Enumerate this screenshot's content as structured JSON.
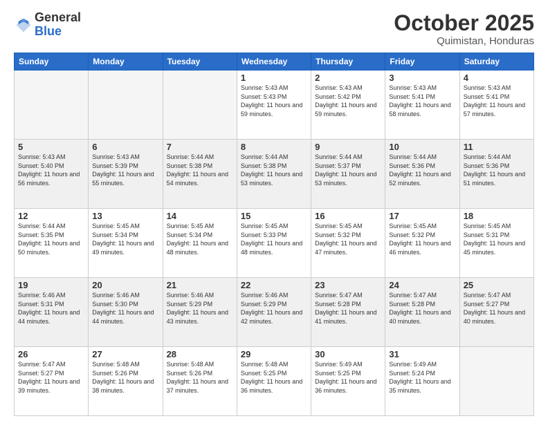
{
  "logo": {
    "general": "General",
    "blue": "Blue"
  },
  "header": {
    "month": "October 2025",
    "location": "Quimistan, Honduras"
  },
  "days_of_week": [
    "Sunday",
    "Monday",
    "Tuesday",
    "Wednesday",
    "Thursday",
    "Friday",
    "Saturday"
  ],
  "weeks": [
    [
      {
        "day": "",
        "empty": true
      },
      {
        "day": "",
        "empty": true
      },
      {
        "day": "",
        "empty": true
      },
      {
        "day": "1",
        "sunrise": "5:43 AM",
        "sunset": "5:43 PM",
        "daylight": "11 hours and 59 minutes."
      },
      {
        "day": "2",
        "sunrise": "5:43 AM",
        "sunset": "5:42 PM",
        "daylight": "11 hours and 59 minutes."
      },
      {
        "day": "3",
        "sunrise": "5:43 AM",
        "sunset": "5:41 PM",
        "daylight": "11 hours and 58 minutes."
      },
      {
        "day": "4",
        "sunrise": "5:43 AM",
        "sunset": "5:41 PM",
        "daylight": "11 hours and 57 minutes."
      }
    ],
    [
      {
        "day": "5",
        "sunrise": "5:43 AM",
        "sunset": "5:40 PM",
        "daylight": "11 hours and 56 minutes."
      },
      {
        "day": "6",
        "sunrise": "5:43 AM",
        "sunset": "5:39 PM",
        "daylight": "11 hours and 55 minutes."
      },
      {
        "day": "7",
        "sunrise": "5:44 AM",
        "sunset": "5:38 PM",
        "daylight": "11 hours and 54 minutes."
      },
      {
        "day": "8",
        "sunrise": "5:44 AM",
        "sunset": "5:38 PM",
        "daylight": "11 hours and 53 minutes."
      },
      {
        "day": "9",
        "sunrise": "5:44 AM",
        "sunset": "5:37 PM",
        "daylight": "11 hours and 53 minutes."
      },
      {
        "day": "10",
        "sunrise": "5:44 AM",
        "sunset": "5:36 PM",
        "daylight": "11 hours and 52 minutes."
      },
      {
        "day": "11",
        "sunrise": "5:44 AM",
        "sunset": "5:36 PM",
        "daylight": "11 hours and 51 minutes."
      }
    ],
    [
      {
        "day": "12",
        "sunrise": "5:44 AM",
        "sunset": "5:35 PM",
        "daylight": "11 hours and 50 minutes."
      },
      {
        "day": "13",
        "sunrise": "5:45 AM",
        "sunset": "5:34 PM",
        "daylight": "11 hours and 49 minutes."
      },
      {
        "day": "14",
        "sunrise": "5:45 AM",
        "sunset": "5:34 PM",
        "daylight": "11 hours and 48 minutes."
      },
      {
        "day": "15",
        "sunrise": "5:45 AM",
        "sunset": "5:33 PM",
        "daylight": "11 hours and 48 minutes."
      },
      {
        "day": "16",
        "sunrise": "5:45 AM",
        "sunset": "5:32 PM",
        "daylight": "11 hours and 47 minutes."
      },
      {
        "day": "17",
        "sunrise": "5:45 AM",
        "sunset": "5:32 PM",
        "daylight": "11 hours and 46 minutes."
      },
      {
        "day": "18",
        "sunrise": "5:45 AM",
        "sunset": "5:31 PM",
        "daylight": "11 hours and 45 minutes."
      }
    ],
    [
      {
        "day": "19",
        "sunrise": "5:46 AM",
        "sunset": "5:31 PM",
        "daylight": "11 hours and 44 minutes."
      },
      {
        "day": "20",
        "sunrise": "5:46 AM",
        "sunset": "5:30 PM",
        "daylight": "11 hours and 44 minutes."
      },
      {
        "day": "21",
        "sunrise": "5:46 AM",
        "sunset": "5:29 PM",
        "daylight": "11 hours and 43 minutes."
      },
      {
        "day": "22",
        "sunrise": "5:46 AM",
        "sunset": "5:29 PM",
        "daylight": "11 hours and 42 minutes."
      },
      {
        "day": "23",
        "sunrise": "5:47 AM",
        "sunset": "5:28 PM",
        "daylight": "11 hours and 41 minutes."
      },
      {
        "day": "24",
        "sunrise": "5:47 AM",
        "sunset": "5:28 PM",
        "daylight": "11 hours and 40 minutes."
      },
      {
        "day": "25",
        "sunrise": "5:47 AM",
        "sunset": "5:27 PM",
        "daylight": "11 hours and 40 minutes."
      }
    ],
    [
      {
        "day": "26",
        "sunrise": "5:47 AM",
        "sunset": "5:27 PM",
        "daylight": "11 hours and 39 minutes."
      },
      {
        "day": "27",
        "sunrise": "5:48 AM",
        "sunset": "5:26 PM",
        "daylight": "11 hours and 38 minutes."
      },
      {
        "day": "28",
        "sunrise": "5:48 AM",
        "sunset": "5:26 PM",
        "daylight": "11 hours and 37 minutes."
      },
      {
        "day": "29",
        "sunrise": "5:48 AM",
        "sunset": "5:25 PM",
        "daylight": "11 hours and 36 minutes."
      },
      {
        "day": "30",
        "sunrise": "5:49 AM",
        "sunset": "5:25 PM",
        "daylight": "11 hours and 36 minutes."
      },
      {
        "day": "31",
        "sunrise": "5:49 AM",
        "sunset": "5:24 PM",
        "daylight": "11 hours and 35 minutes."
      },
      {
        "day": "",
        "empty": true
      }
    ]
  ]
}
